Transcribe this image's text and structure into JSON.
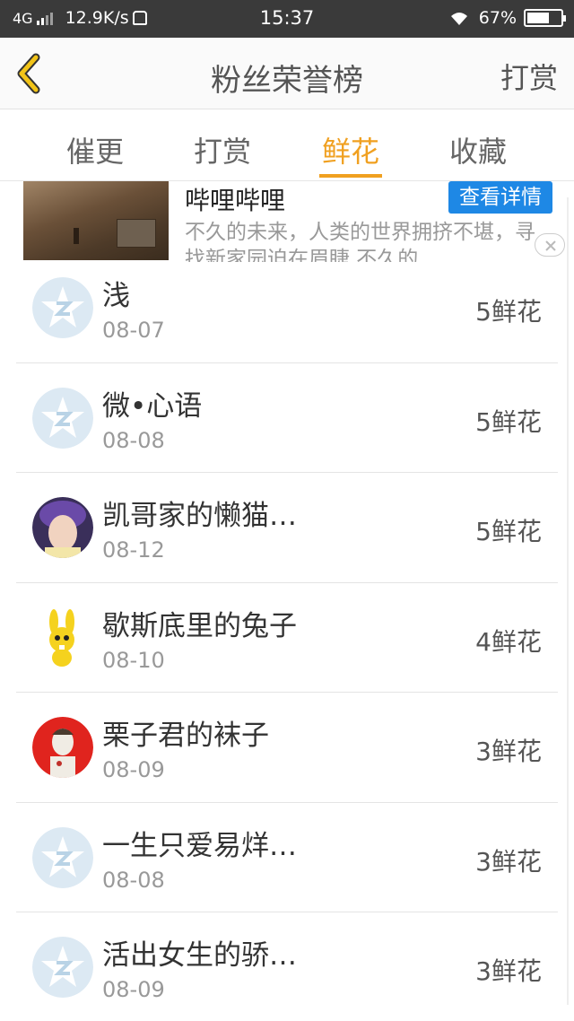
{
  "status_bar": {
    "network": "4G",
    "speed": "12.9K/s",
    "time": "15:37",
    "battery": "67%",
    "battery_level": 0.67
  },
  "header": {
    "title": "粉丝荣誉榜",
    "action_label": "打赏"
  },
  "tabs": [
    {
      "label": "催更"
    },
    {
      "label": "打赏"
    },
    {
      "label": "鲜花"
    },
    {
      "label": "收藏"
    }
  ],
  "active_tab": "鲜花",
  "ad": {
    "title": "哔哩哔哩",
    "button_label": "查看详情",
    "description": "不久的未来，人类的世界拥挤不堪，寻找新家园迫在眉睫 不久的"
  },
  "fans": [
    {
      "name": "浅",
      "date": "08-07",
      "count": "5鲜花",
      "avatar": "default-avatar-icon"
    },
    {
      "name": "微•心语",
      "date": "08-08",
      "count": "5鲜花",
      "avatar": "default-avatar-icon"
    },
    {
      "name": "凯哥家的懒猫…",
      "date": "08-12",
      "count": "5鲜花",
      "avatar": "portrait-avatar"
    },
    {
      "name": "歇斯底里的兔子",
      "date": "08-10",
      "count": "4鲜花",
      "avatar": "rabbit-avatar"
    },
    {
      "name": "栗子君的袜子",
      "date": "08-09",
      "count": "3鲜花",
      "avatar": "illustrated-avatar"
    },
    {
      "name": "一生只爱易烊…",
      "date": "08-08",
      "count": "3鲜花",
      "avatar": "default-avatar-icon"
    },
    {
      "name": "活出女生的骄…",
      "date": "08-09",
      "count": "3鲜花",
      "avatar": "default-avatar-icon"
    }
  ],
  "colors": {
    "accent": "#f0a020",
    "back_arrow": "#f2c418",
    "ad_button": "#1e88e5",
    "default_avatar": "#dce9f3"
  }
}
